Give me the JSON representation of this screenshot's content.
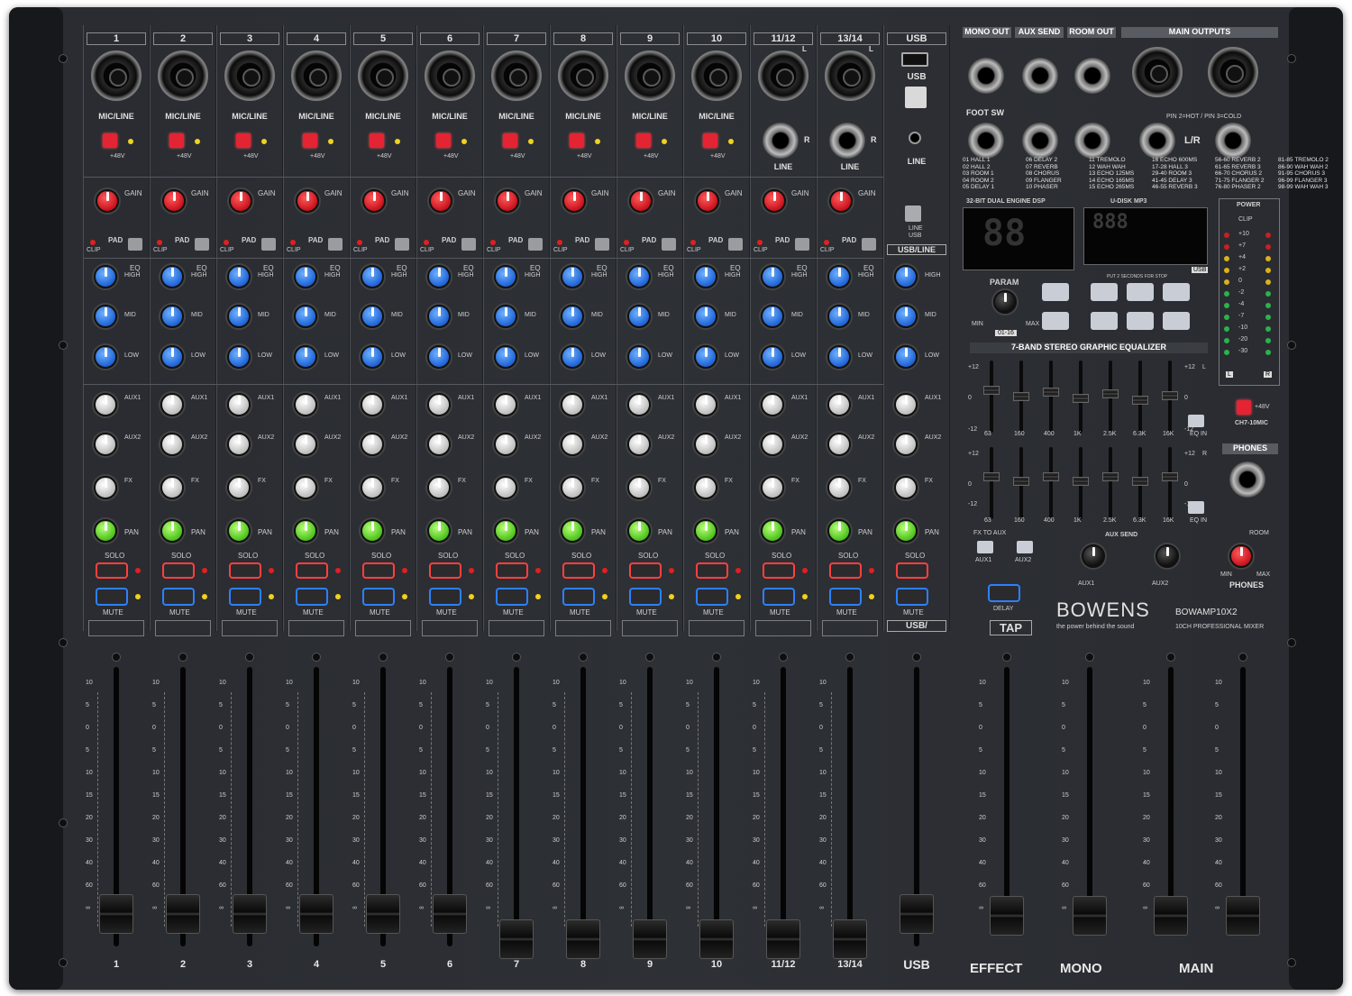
{
  "brand": {
    "name": "BOWENS",
    "tagline": "the power behind the sound",
    "model": "BOWAMP10X2",
    "model_desc": "10CH PROFESSIONAL MIXER"
  },
  "channels": [
    {
      "num": "1",
      "bottom": "1",
      "input": "MIC/LINE"
    },
    {
      "num": "2",
      "bottom": "2",
      "input": "MIC/LINE"
    },
    {
      "num": "3",
      "bottom": "3",
      "input": "MIC/LINE"
    },
    {
      "num": "4",
      "bottom": "4",
      "input": "MIC/LINE"
    },
    {
      "num": "5",
      "bottom": "5",
      "input": "MIC/LINE"
    },
    {
      "num": "6",
      "bottom": "6",
      "input": "MIC/LINE"
    },
    {
      "num": "7",
      "bottom": "7",
      "input": "MIC/LINE"
    },
    {
      "num": "8",
      "bottom": "8",
      "input": "MIC/LINE"
    },
    {
      "num": "9",
      "bottom": "9",
      "input": "MIC/LINE"
    },
    {
      "num": "10",
      "bottom": "10",
      "input": "MIC/LINE"
    },
    {
      "num": "11/12",
      "bottom": "11/12",
      "input": "LINE"
    },
    {
      "num": "13/14",
      "bottom": "13/14",
      "input": "LINE"
    }
  ],
  "channel_labels": {
    "phantom": "+48V",
    "gain": "GAIN",
    "pad": "PAD",
    "clip": "CLIP",
    "eq": "EQ",
    "high": "HIGH",
    "mid": "MID",
    "low": "LOW",
    "aux1": "AUX1",
    "aux2": "AUX2",
    "fx": "FX",
    "pan": "PAN",
    "solo": "SOLO",
    "mute": "MUTE"
  },
  "usb_strip": {
    "title": "USB",
    "usb_label": "USB",
    "line_label": "LINE",
    "switch_label": "USB/LINE",
    "bottom_box": "USB/",
    "bottom": "USB"
  },
  "outputs": {
    "mono_out": "MONO OUT",
    "aux_send": "AUX SEND",
    "room_out": "ROOM OUT",
    "main_outputs": "MAIN OUTPUTS",
    "foot_sw": "FOOT SW",
    "pin_note": "PIN 2=HOT / PIN 3=COLD",
    "lr": "L/R"
  },
  "fx_presets": "01 HALL 1\n02 HALL 2\n03 ROOM 1\n04 ROOM 2\n05 DELAY 1|06 DELAY 2\n07 REVERB\n08 CHORUS\n09 FLANGER\n10 PHASER|11 TREMOLO\n12 WAH WAH\n13 ECHO 125MS\n14 ECHO 165MS\n15 ECHO 265MS|16 ECHO 600MS\n17-28 HALL 3\n29-40 ROOM 3\n41-45 DELAY 3\n46-55 REVERB 3|56-60 REVERB 2\n61-65 REVERB 3\n66-70 CHORUS 2\n71-75 FLANGER 2\n76-80 PHASER 2|81-85 TREMOLO 2\n86-90 WAH WAH 2\n91-95 CHORUS 3\n96-99 FLANGER 3\n98-99 WAH WAH 3",
  "dsp": {
    "title": "32-BIT DUAL ENGINE DSP",
    "display": "88",
    "param": "PARAM",
    "min": "MIN",
    "max": "MAX",
    "range": "01-16"
  },
  "mp3": {
    "title": "U-DISK MP3",
    "display": "888",
    "hint": "PUT 2 SECONDS FOR STOP",
    "usb_tag": "USB"
  },
  "graphic_eq": {
    "title": "7-BAND STEREO GRAPHIC EQUALIZER",
    "bands": [
      "63",
      "160",
      "400",
      "1K",
      "2.5K",
      "6.3K",
      "16K"
    ],
    "top": "+12",
    "mid": "0",
    "bottom": "-12",
    "eq_in": "EQ IN",
    "ch_l": "L",
    "ch_r": "R"
  },
  "meter": {
    "power": "POWER",
    "clip": "CLIP",
    "levels": [
      "+10",
      "+7",
      "+4",
      "+2",
      "0",
      "-2",
      "-4",
      "-7",
      "-10",
      "-20",
      "-30"
    ],
    "left": "L",
    "right": "R"
  },
  "ch7_10mic": {
    "label": "CH7-10MIC",
    "phantom": "+48V"
  },
  "phones": {
    "title": "PHONES",
    "label": "PHONES",
    "room": "ROOM",
    "min": "MIN",
    "max": "MAX"
  },
  "fx_section": {
    "fx_to_aux": "FX TO AUX",
    "aux1": "AUX1",
    "aux2": "AUX2",
    "delay": "DELAY",
    "tap": "TAP",
    "aux_send_title": "AUX SEND"
  },
  "master_labels": {
    "effect": "EFFECT",
    "mono": "MONO",
    "main": "MAIN"
  },
  "fader_scale": [
    "10",
    "5",
    "0",
    "5",
    "10",
    "15",
    "20",
    "30",
    "40",
    "60",
    "∞"
  ],
  "colors": {
    "solo": "#ff4040",
    "mute": "#2d80ff",
    "gain": "#e0202a",
    "eq": "#1f63d6",
    "pan": "#4cc21c",
    "phantom": "#e32432"
  }
}
